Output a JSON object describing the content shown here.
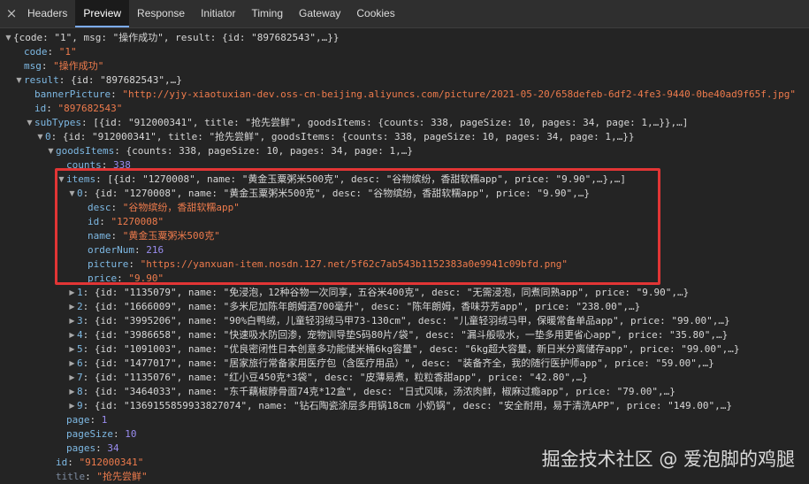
{
  "devtools": {
    "close_icon": "×",
    "tabs": [
      "Headers",
      "Preview",
      "Response",
      "Initiator",
      "Timing",
      "Gateway",
      "Cookies"
    ]
  },
  "tree": {
    "root_summary": "{code: \"1\", msg: \"操作成功\", result: {id: \"897682543\",…}}",
    "code": "\"1\"",
    "msg": "\"操作成功\"",
    "result_summary": "{id: \"897682543\",…}",
    "bannerPicture": "\"http://yjy-xiaotuxian-dev.oss-cn-beijing.aliyuncs.com/picture/2021-05-20/658defeb-6df2-4fe3-9440-0be40ad9f65f.jpg\"",
    "result_id": "\"897682543\"",
    "subTypes_summary": "[{id: \"912000341\", title: \"抢先尝鲜\", goodsItems: {counts: 338, pageSize: 10, pages: 34, page: 1,…}},…]",
    "sub0_summary": "{id: \"912000341\", title: \"抢先尝鲜\", goodsItems: {counts: 338, pageSize: 10, pages: 34, page: 1,…}}",
    "goodsItems_summary": "{counts: 338, pageSize: 10, pages: 34, page: 1,…}",
    "counts": "338",
    "items_summary": "[{id: \"1270008\", name: \"黄金玉粟粥米500克\", desc: \"谷物缤纷，香甜软糯app\", price: \"9.90\",…},…]",
    "item0_summary": "{id: \"1270008\", name: \"黄金玉粟粥米500克\", desc: \"谷物缤纷，香甜软糯app\", price: \"9.90\",…}",
    "item0": {
      "desc": "\"谷物缤纷，香甜软糯app\"",
      "id": "\"1270008\"",
      "name": "\"黄金玉粟粥米500克\"",
      "orderNum": "216",
      "picture": "\"https://yanxuan-item.nosdn.127.net/5f62c7ab543b1152383a0e9941c09bfd.png\"",
      "price": "\"9.90\""
    },
    "items_rest": [
      {
        "idx": "1",
        "summary": "{id: \"1135079\", name: \"免浸泡，12种谷物一次同享，五谷米400克\", desc: \"无需浸泡，同煮同熟app\", price: \"9.90\",…}"
      },
      {
        "idx": "2",
        "summary": "{id: \"1666009\", name: \"多米尼加陈年朗姆酒700毫升\", desc: \"陈年朗姆，香味芬芳app\", price: \"238.00\",…}"
      },
      {
        "idx": "3",
        "summary": "{id: \"3995206\", name: \"90%白鸭绒，儿童轻羽绒马甲73-130cm\", desc: \"儿童轻羽绒马甲，保暖常备单品app\", price: \"99.00\",…}"
      },
      {
        "idx": "4",
        "summary": "{id: \"3986658\", name: \"快速吸水防回渗，宠物训导垫S码80片/袋\", desc: \"漏斗般吸水，一垫多用更省心app\", price: \"35.80\",…}"
      },
      {
        "idx": "5",
        "summary": "{id: \"1091003\", name: \"优良密闭性日本创意多功能储米桶6kg容量\", desc: \"6kg超大容量，新日米分离储存app\", price: \"99.00\",…}"
      },
      {
        "idx": "6",
        "summary": "{id: \"1477017\", name: \"居家旅行常备家用医疗包（含医疗用品）\", desc: \"装备齐全，我的随行医护师app\", price: \"59.00\",…}"
      },
      {
        "idx": "7",
        "summary": "{id: \"1135076\", name: \"红小豆450克*3袋\", desc: \"皮薄易煮，粒粒香甜app\", price: \"42.80\",…}"
      },
      {
        "idx": "8",
        "summary": "{id: \"3464033\", name: \"东千藕椒脖骨面74克*12盒\", desc: \"日式风味，汤浓肉鲜，椒麻过瘾app\", price: \"79.00\",…}"
      },
      {
        "idx": "9",
        "summary": "{id: \"1369155859933827074\", name: \"钻石陶瓷涂层多用锅18cm 小奶锅\", desc: \"安全耐用，易于清洗APP\", price: \"149.00\",…}"
      }
    ],
    "page": "1",
    "pageSize": "10",
    "pages": "34",
    "sub0_id": "\"912000341\"",
    "sub0_title_partial": "\"抢先尝鲜\""
  },
  "watermark": "掘金技术社区 @ 爱泡脚的鸡腿"
}
